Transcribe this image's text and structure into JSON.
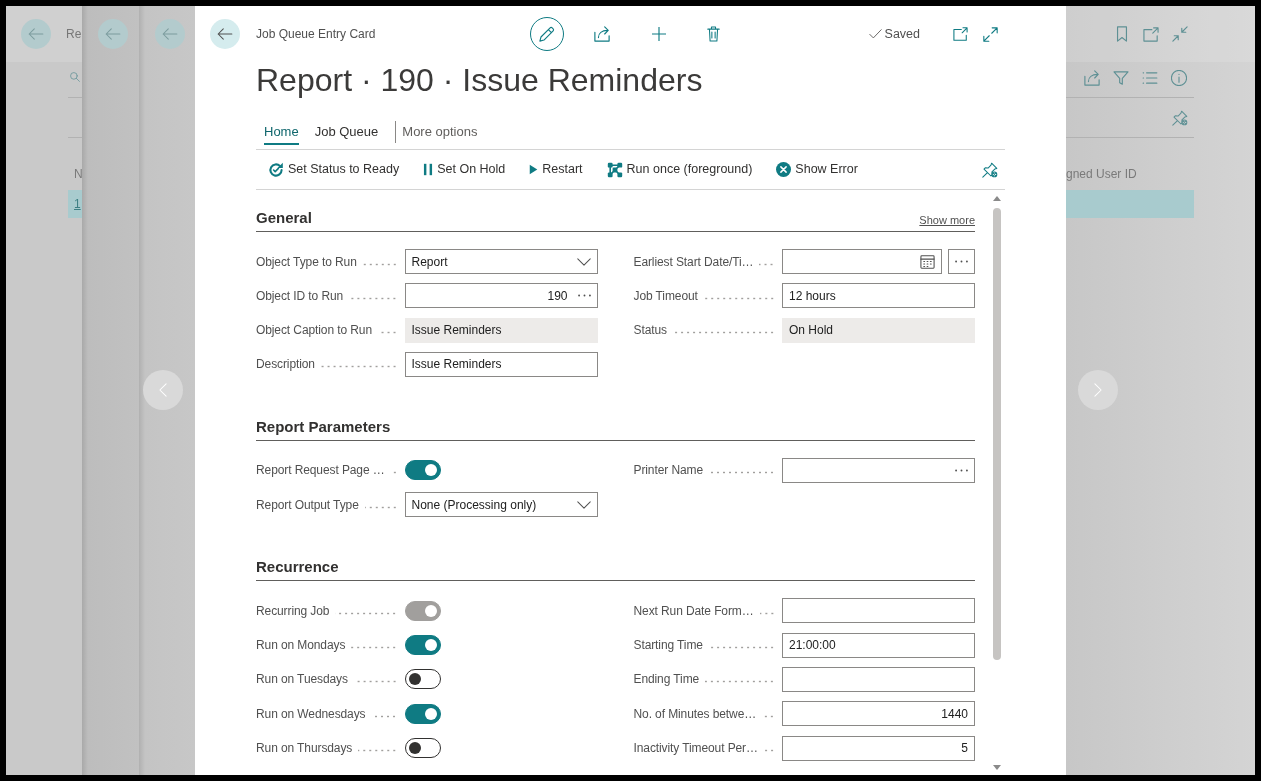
{
  "background_page": {
    "title": "Re",
    "columns": [
      "N",
      "gned User ID"
    ],
    "rows": [
      {
        "cells": [
          "1"
        ],
        "selected": true
      }
    ]
  },
  "card": {
    "caption": "Job Queue Entry Card",
    "save_state": "Saved",
    "title": "Report · 190 · Issue Reminders",
    "tabs": [
      {
        "label": "Home",
        "kind": "tab",
        "selected": true
      },
      {
        "label": "Job Queue",
        "kind": "tab",
        "selected": false
      },
      {
        "label": "More options",
        "kind": "more",
        "selected": false
      }
    ],
    "actions": [
      "Set Status to Ready",
      "Set On Hold",
      "Restart",
      "Run once (foreground)",
      "Show Error"
    ],
    "sections": [
      {
        "title": "General",
        "show_more": "Show more",
        "left": [
          {
            "label": "Object Type to Run",
            "kind": "dropdown",
            "value": "Report",
            "disabled": false
          },
          {
            "label": "Object ID to Run",
            "kind": "number",
            "value": "190",
            "lookup": true,
            "disabled": false
          },
          {
            "label": "Object Caption to Run",
            "kind": "text",
            "value": "Issue Reminders",
            "disabled": true
          },
          {
            "label": "Description",
            "kind": "text",
            "value": "Issue Reminders",
            "disabled": false
          }
        ],
        "right": [
          {
            "label": "Earliest Start Date/Ti…",
            "kind": "datetime",
            "disabled": false
          },
          {
            "label": "Job Timeout",
            "kind": "text",
            "value": "12 hours",
            "disabled": false
          },
          {
            "label": "Status",
            "kind": "text",
            "value": "On Hold",
            "disabled": true
          }
        ]
      },
      {
        "title": "Report Parameters",
        "left": [
          {
            "label": "Report Request Page …",
            "kind": "toggle",
            "on": true,
            "disabled": false
          },
          {
            "label": "Report Output Type",
            "kind": "dropdown",
            "value": "None (Processing only)",
            "disabled": false
          }
        ],
        "right": [
          {
            "label": "Printer Name",
            "kind": "text",
            "lookup": true,
            "disabled": false
          }
        ]
      },
      {
        "title": "Recurrence",
        "left": [
          {
            "label": "Recurring Job",
            "kind": "toggle",
            "on": true,
            "disabled": true
          },
          {
            "label": "Run on Mondays",
            "kind": "toggle",
            "on": true,
            "disabled": false
          },
          {
            "label": "Run on Tuesdays",
            "kind": "toggle",
            "on": false,
            "disabled": false
          },
          {
            "label": "Run on Wednesdays",
            "kind": "toggle",
            "on": true,
            "disabled": false
          },
          {
            "label": "Run on Thursdays",
            "kind": "toggle",
            "on": false,
            "disabled": false
          }
        ],
        "right": [
          {
            "label": "Next Run Date Form…",
            "kind": "text",
            "disabled": false
          },
          {
            "label": "Starting Time",
            "kind": "text",
            "value": "21:00:00",
            "disabled": false
          },
          {
            "label": "Ending Time",
            "kind": "text",
            "disabled": false
          },
          {
            "label": "No. of Minutes betwe…",
            "kind": "number",
            "value": "1440",
            "disabled": false
          },
          {
            "label": "Inactivity Timeout Per…",
            "kind": "number",
            "value": "5",
            "disabled": false
          }
        ]
      }
    ]
  }
}
